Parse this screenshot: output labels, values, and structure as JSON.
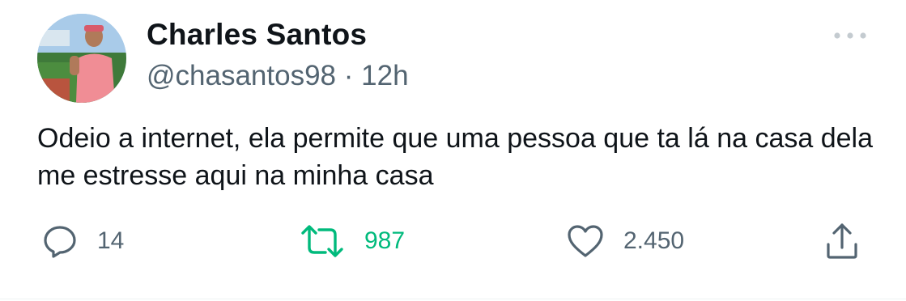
{
  "author": {
    "display_name": "Charles Santos",
    "handle": "@chasantos98",
    "separator": "·",
    "time": "12h"
  },
  "tweet": {
    "text": "Odeio a internet, ela permite que uma pessoa que ta lá na casa dela me estresse aqui na minha casa"
  },
  "actions": {
    "reply_count": "14",
    "retweet_count": "987",
    "like_count": "2.450"
  },
  "colors": {
    "text": "#0f1419",
    "secondary": "#536471",
    "retweet_active": "#00ba7c"
  },
  "icons": {
    "avatar": "profile-photo",
    "more": "more-horizontal-icon",
    "reply": "reply-bubble-icon",
    "retweet": "retweet-icon",
    "like": "heart-icon",
    "share": "share-icon"
  }
}
